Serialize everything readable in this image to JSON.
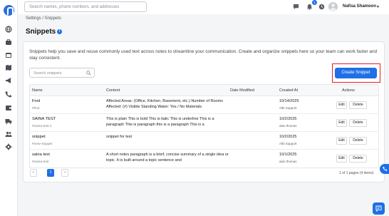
{
  "topbar": {
    "search_placeholder": "Search names, phone numbers, and addresses",
    "notification_count": "1",
    "user_name": "Nafisa Shamoon"
  },
  "breadcrumb": "Settings / Snippets",
  "page_title": "Snippets",
  "description": "Snippets help you save and reuse commonly used text across notes to streamline your communication. Create and organize snippets here so your team can work faster and stay consistent.",
  "snippet_search_placeholder": "Search snippets",
  "create_button": "Create Snippet",
  "table": {
    "headers": [
      "Name",
      "Content",
      "Date Modified",
      "Created At",
      "Actions"
    ],
    "rows": [
      {
        "name": "Fnol",
        "tag": "#fnol",
        "content": "Affected Areas: (Office, Kitchen, Basement, etc.) Number of Rooms Affected: (#) Visible Standing Water: Yes / No Materials",
        "date_modified": "",
        "created_at": "10/14/2025",
        "created_by": "Albi Support",
        "edit": "Edit",
        "delete": "Delete"
      },
      {
        "name": "SAINA TEST",
        "tag": "#saina-test-1",
        "content": "This is plain This is bold This is italic This is underline This is a paragraph This is paragraph this is a paragraph This is a",
        "date_modified": "",
        "created_at": "10/2/2025",
        "created_by": "alan thomas",
        "edit": "Edit",
        "delete": "Delete"
      },
      {
        "name": "snippet",
        "tag": "#new-snippet",
        "content": "snippet for test",
        "date_modified": "",
        "created_at": "10/2/2025",
        "created_by": "Albi Support",
        "edit": "Edit",
        "delete": "Delete"
      },
      {
        "name": "saina test",
        "tag": "#saina-test",
        "content": "A short notes paragraph is a brief, concise summary of a single idea or topic. It is built around a topic sentence and",
        "date_modified": "",
        "created_at": "10/1/2025",
        "created_by": "alan thomas",
        "edit": "Edit",
        "delete": "Delete"
      }
    ]
  },
  "pagination": {
    "prev": "<",
    "current": "1",
    "next": ">",
    "info": "1 of 1 pages (4 items)"
  },
  "colors": {
    "accent": "#1f6fe6",
    "highlight_outline": "#e01e26"
  },
  "icons": {
    "sidebar": [
      "globe-icon",
      "briefcase-icon",
      "calendar-icon",
      "map-icon",
      "megaphone-icon",
      "phone-icon",
      "wallet-icon",
      "truck-icon",
      "users-icon",
      "gear-icon"
    ],
    "topbar": [
      "chat-icon",
      "bell-icon",
      "clock-icon"
    ]
  }
}
